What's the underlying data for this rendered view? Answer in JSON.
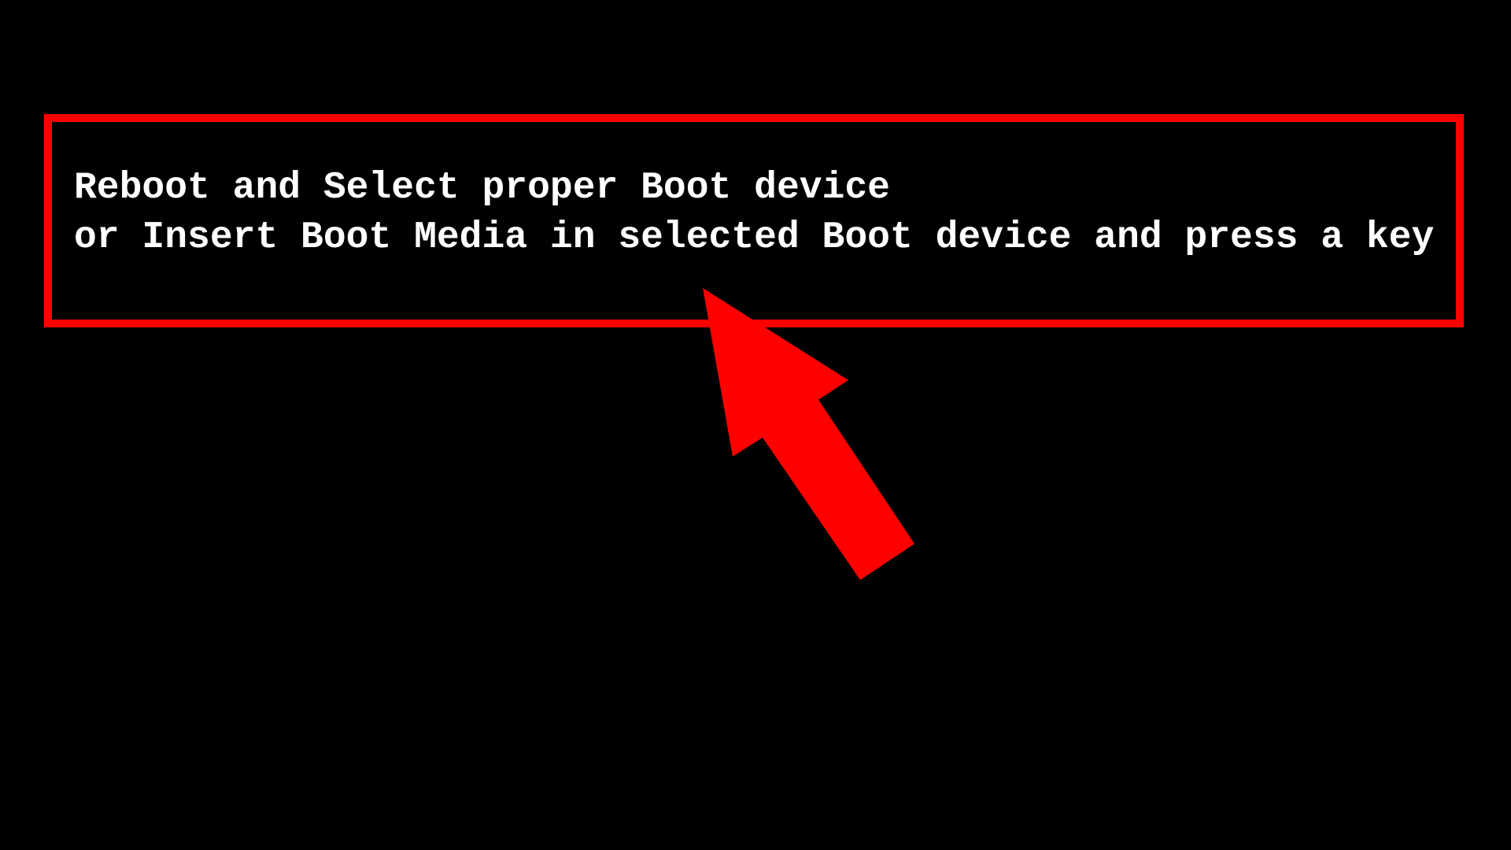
{
  "screen": {
    "type": "bios-boot-error",
    "background_color": "#000000",
    "text_color": "#ffffff"
  },
  "message": {
    "line1": "Reboot and Select proper Boot device",
    "line2": "or Insert Boot Media in selected Boot device and press a key"
  },
  "annotation": {
    "highlight_color": "#ff0000",
    "box": "highlight-rectangle",
    "arrow": "arrow-up-left-icon"
  }
}
